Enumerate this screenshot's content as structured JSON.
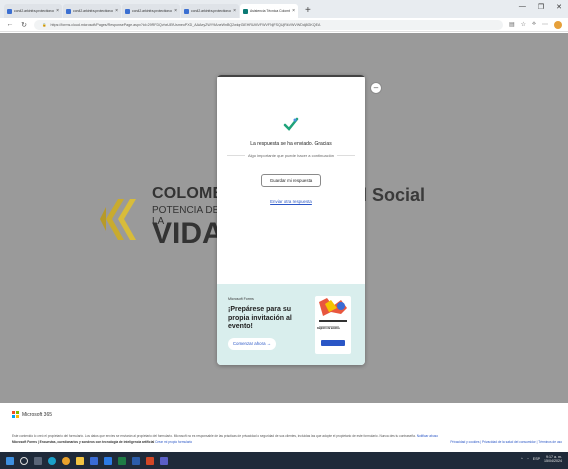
{
  "browser": {
    "tabs": [
      {
        "label": "con42.arkinfra.protectionoutlo",
        "active": false
      },
      {
        "label": "con42.arkinfra.protectionoutlo",
        "active": false
      },
      {
        "label": "con42.arkinfra.protectionoutlo",
        "active": false
      },
      {
        "label": "con42.arkinfra.protectionoutlo",
        "active": false
      },
      {
        "label": "Asistencia Técnica Colombia Pote",
        "active": true
      }
    ],
    "url": "https://forms.cloud.microsoft/Pages/ResponsePage.aspx?id=29RFDQvhxUEfUsmeoPXD_AAAeyZWY9AneWnBQ2wlqrGlEHRUMVFWVFNjFSQUjRkVWVWDdj8GKQEA"
  },
  "background": {
    "logo_line1": "COLOMBIA",
    "logo_line2": "POTENCIA DE LA",
    "logo_line3": "VIDA",
    "partial_heading": "l Social",
    "logo_colors": [
      "#f5c400",
      "#8a8a8a"
    ]
  },
  "dialog": {
    "title": "La respuesta se ha enviado. Gracias",
    "subtitle": "Algo importante que puede hacer a continuación",
    "save_button": "Guardar mi respuesta",
    "send_link": "Enviar otra respuesta",
    "close_icon": "x-icon",
    "promo": {
      "brand": "Microsoft Forms",
      "heading": "¡Prepárese para su propia invitación al evento!",
      "button": "Comenzar ahora →",
      "card_label": "Registro de eventos"
    }
  },
  "footer": {
    "brand": "Microsoft 365",
    "disclaimer": "Este contenido lo creó el propietario del formulario. Los datos que envíes se enviarán al propietario del formulario. Microsoft no es responsable de las prácticas de privacidad o seguridad de sus clientes, incluidas las que adopte el propietario de este formulario. Nunca des tu contraseña.",
    "report_link": "Notificar abuso",
    "forms_line": "Microsoft Forms | Encuestas, cuestionarios y sondeos con tecnología de inteligencia artificial",
    "create_link": "Crear mi propio formulario",
    "right_links": "Privacidad y cookies | Privacidad de la salud del consumidor | Términos de uso"
  },
  "taskbar": {
    "lang": "ESP",
    "time": "9:17 a. m.",
    "date": "15/04/2024"
  }
}
